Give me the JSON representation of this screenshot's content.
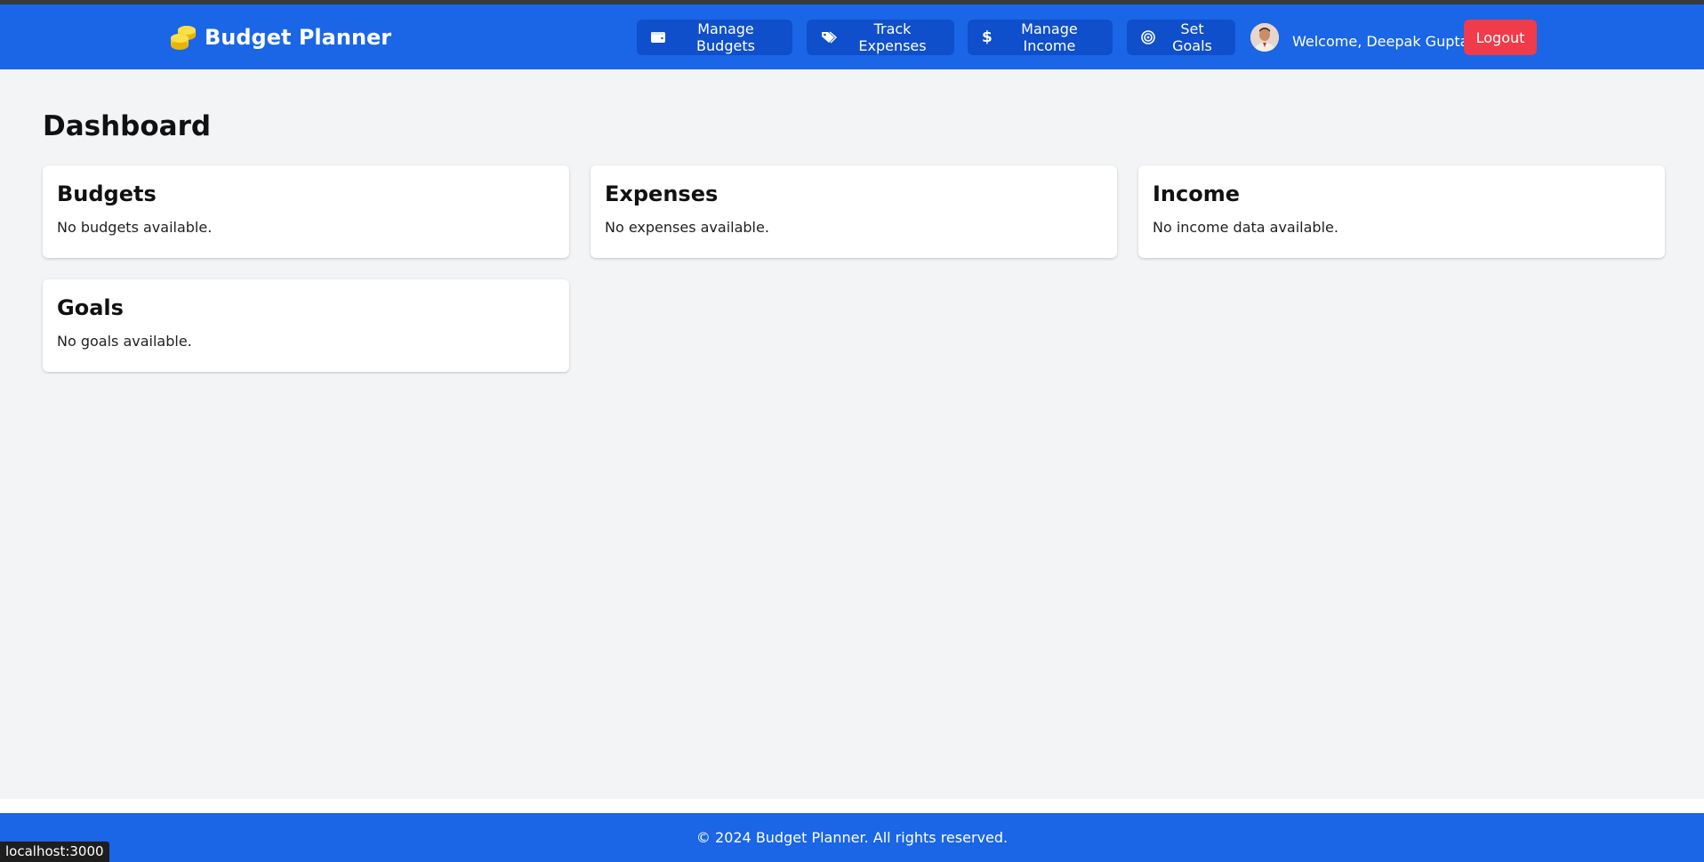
{
  "header": {
    "brand": "Budget Planner",
    "nav": [
      {
        "label": "Manage Budgets",
        "icon": "wallet-icon"
      },
      {
        "label": "Track Expenses",
        "icon": "tags-icon"
      },
      {
        "label": "Manage Income",
        "icon": "dollar-icon"
      },
      {
        "label": "Set Goals",
        "icon": "target-icon"
      }
    ],
    "welcome": "Welcome, Deepak Gupta",
    "logout": "Logout"
  },
  "main": {
    "title": "Dashboard",
    "cards": [
      {
        "title": "Budgets",
        "text": "No budgets available."
      },
      {
        "title": "Expenses",
        "text": "No expenses available."
      },
      {
        "title": "Income",
        "text": "No income data available."
      },
      {
        "title": "Goals",
        "text": "No goals available."
      }
    ]
  },
  "footer": {
    "text": "© 2024 Budget Planner. All rights reserved."
  },
  "status_bar": {
    "url": "localhost:3000"
  },
  "colors": {
    "primary": "#1a66e6",
    "nav_button": "#0f4fcc",
    "logout": "#ef3b4a",
    "background": "#f3f4f6"
  }
}
